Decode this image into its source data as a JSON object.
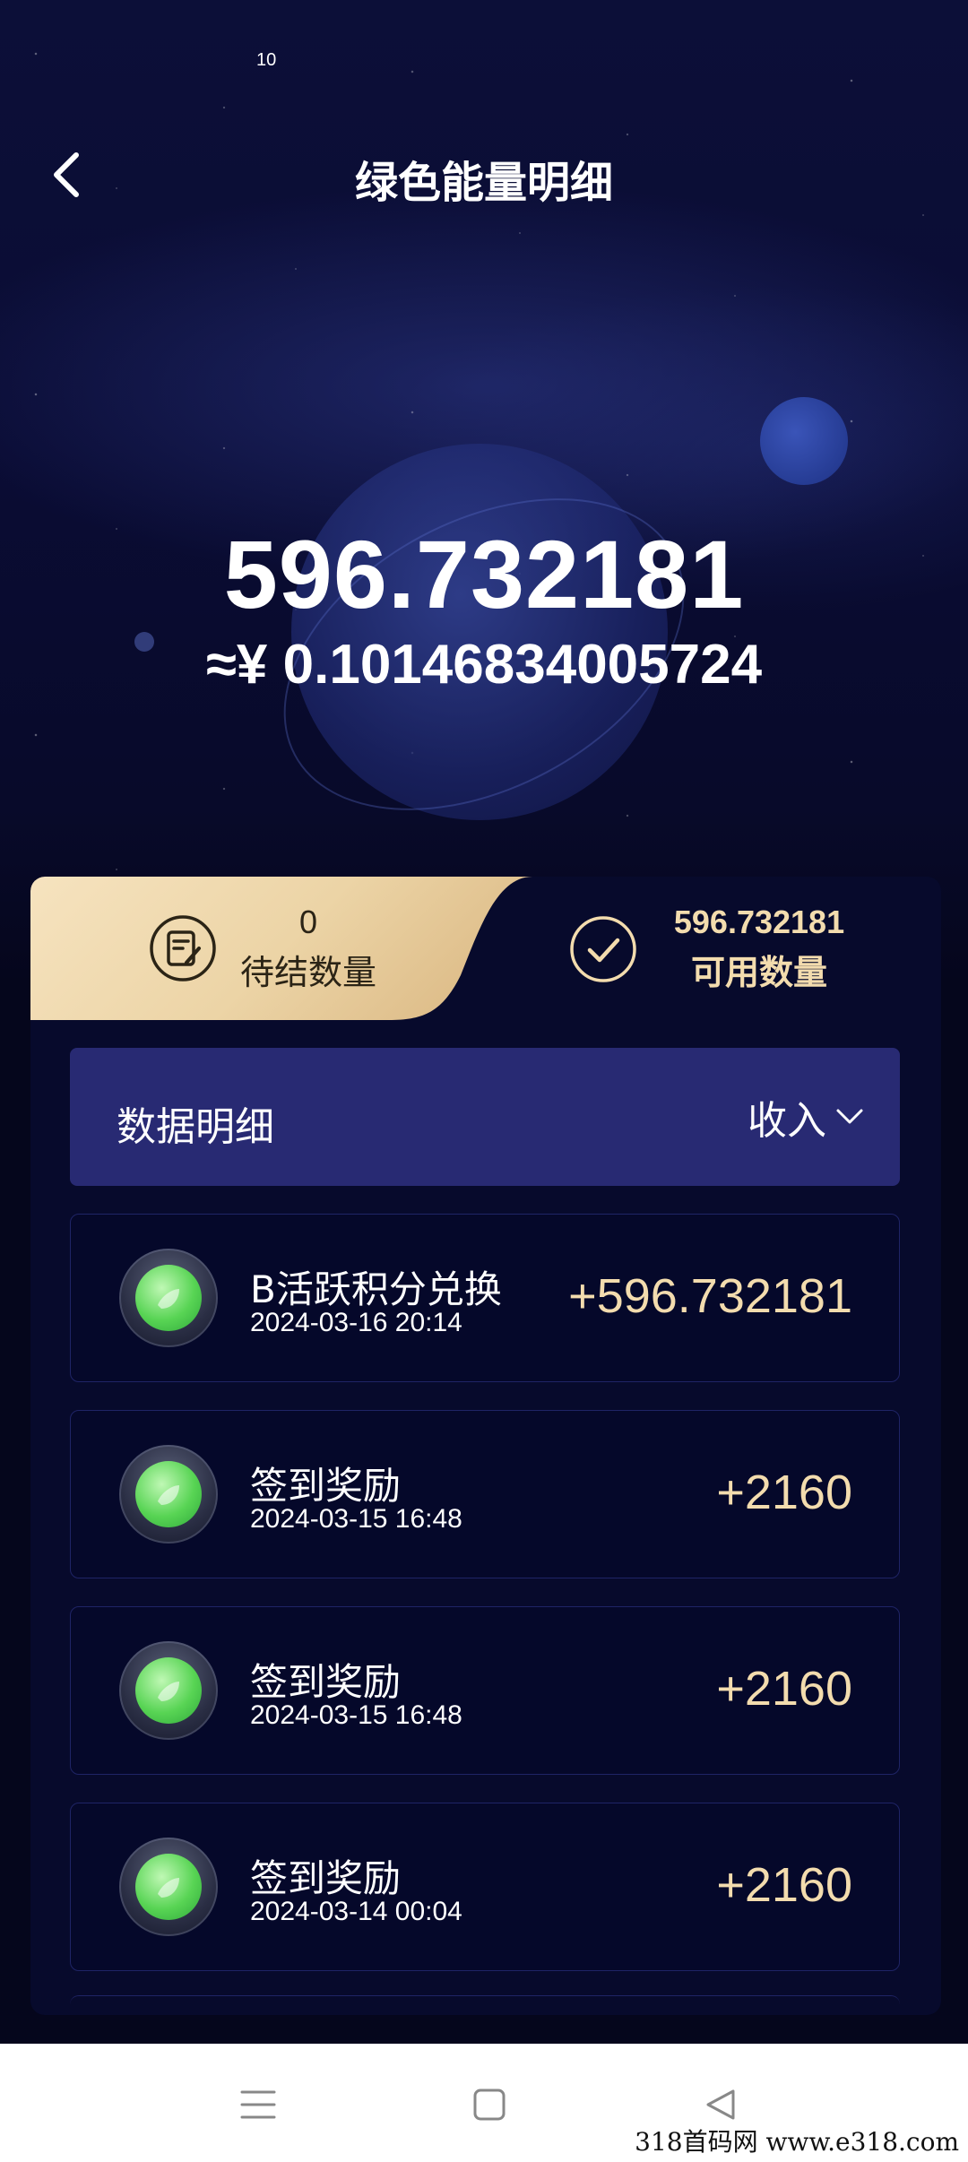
{
  "status_bar": {
    "badge": "10"
  },
  "header": {
    "title": "绿色能量明细",
    "back_icon": "chevron-left-icon"
  },
  "balance": {
    "amount": "596.732181",
    "cny_value": "≈¥ 0.10146834005724"
  },
  "tabs": {
    "pending": {
      "count": "0",
      "label": "待结数量",
      "icon": "document-edit-icon"
    },
    "available": {
      "count": "596.732181",
      "label": "可用数量",
      "icon": "check-circle-icon"
    }
  },
  "section": {
    "title": "数据明细",
    "filter_value": "收入",
    "filter_icon": "chevron-down-icon"
  },
  "records": [
    {
      "title": "B活跃积分兑换",
      "date": "2024-03-16 20:14",
      "amount": "+596.732181"
    },
    {
      "title": "签到奖励",
      "date": "2024-03-15 16:48",
      "amount": "+2160"
    },
    {
      "title": "签到奖励",
      "date": "2024-03-15 16:48",
      "amount": "+2160"
    },
    {
      "title": "签到奖励",
      "date": "2024-03-14 00:04",
      "amount": "+2160"
    }
  ],
  "nav": {
    "menu_icon": "menu-icon",
    "home_icon": "home-square-icon",
    "back_icon": "back-triangle-icon"
  },
  "watermark": "318首码网 www.e318.com",
  "colors": {
    "gold": "#f3dcae",
    "card_bg": "#070a2c",
    "section_bg": "#282a73",
    "coin_green": "#58d454"
  }
}
